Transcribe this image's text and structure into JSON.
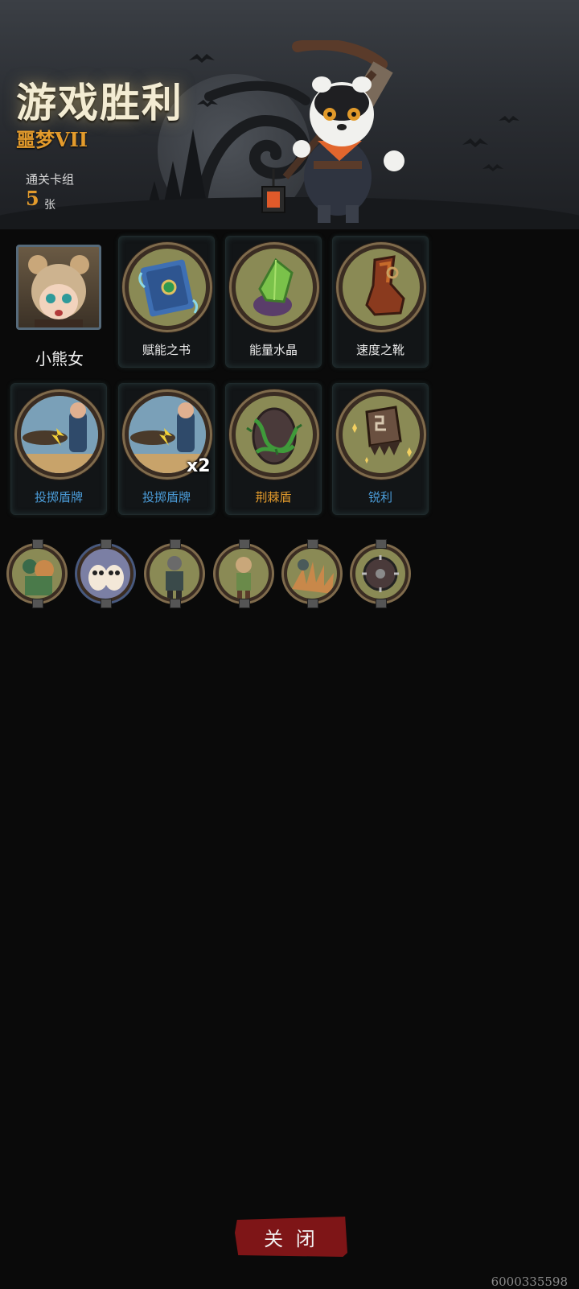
{
  "header": {
    "title": "游戏胜利",
    "difficulty": "噩梦VII",
    "deck_label": "通关卡组",
    "deck_count": "5",
    "deck_unit": "张"
  },
  "hero": {
    "name": "小熊女"
  },
  "cards": [
    {
      "label": "赋能之书",
      "color": "#ececec",
      "icon": "spell-book-icon"
    },
    {
      "label": "能量水晶",
      "color": "#ececec",
      "icon": "energy-crystal-icon"
    },
    {
      "label": "速度之靴",
      "color": "#ececec",
      "icon": "speed-boots-icon"
    },
    {
      "label": "投掷盾牌",
      "color": "#4b9cd8",
      "icon": "throw-shield-icon"
    },
    {
      "label": "投掷盾牌",
      "color": "#4b9cd8",
      "icon": "throw-shield-icon",
      "multiplier": "x2"
    },
    {
      "label": "荆棘盾",
      "color": "#e39b2c",
      "icon": "thorn-shield-icon"
    },
    {
      "label": "锐利",
      "color": "#4b9cd8",
      "icon": "sharp-icon"
    }
  ],
  "tokens": [
    {
      "icon": "bear-warrior-token-icon"
    },
    {
      "icon": "owls-token-icon"
    },
    {
      "icon": "rogue-token-icon"
    },
    {
      "icon": "girl-hero-token-icon"
    },
    {
      "icon": "spiky-beast-token-icon"
    },
    {
      "icon": "spiked-shield-token-icon"
    }
  ],
  "close_button": {
    "label": "关 闭"
  },
  "watermark": "6000335598"
}
